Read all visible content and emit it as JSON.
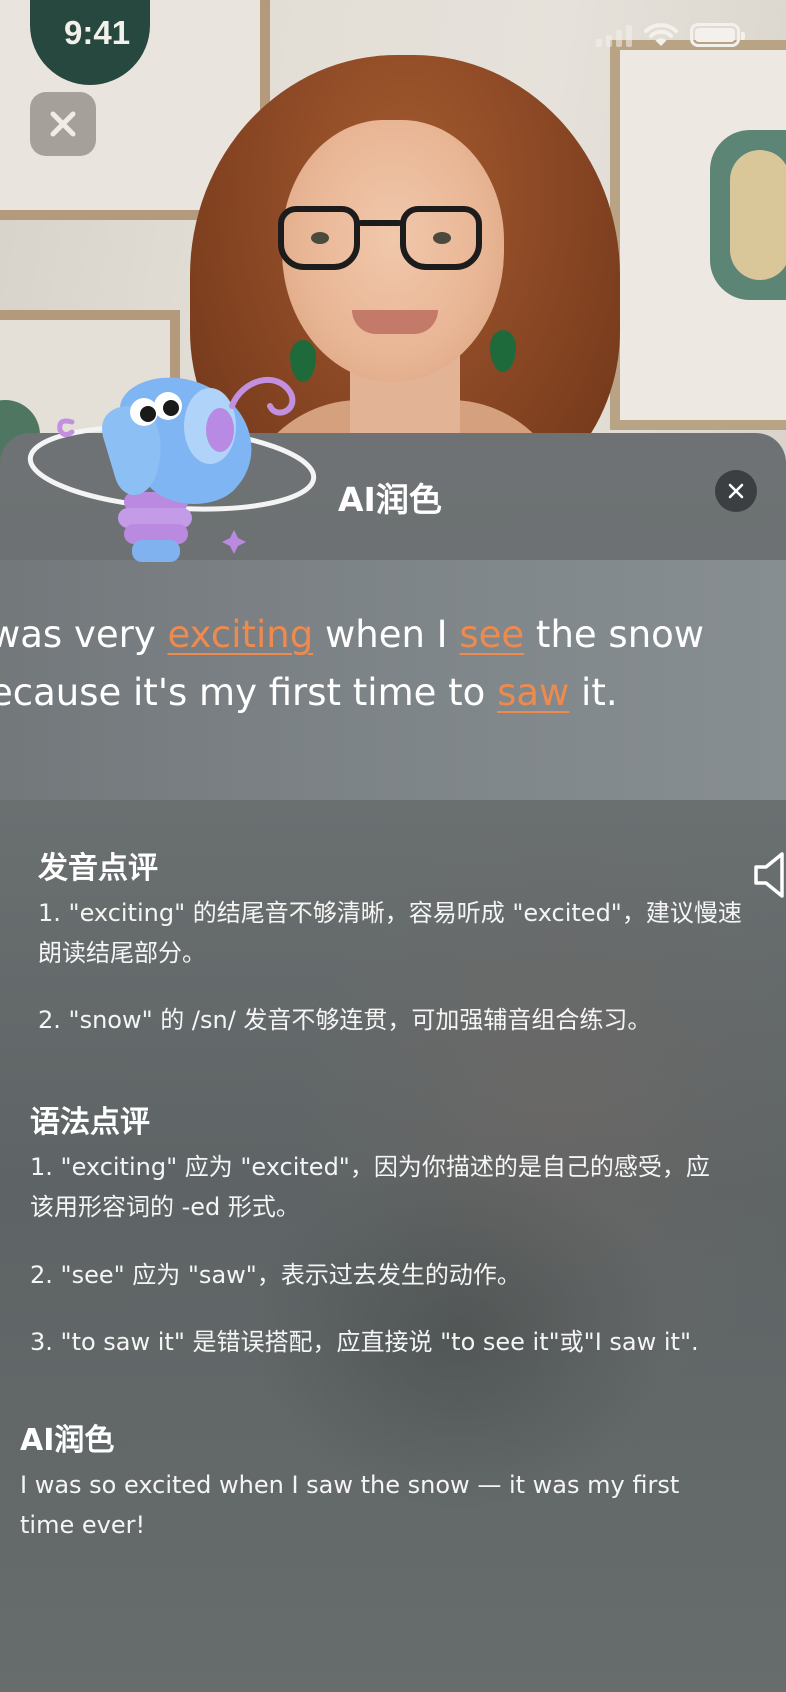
{
  "status_bar": {
    "time": "9:41"
  },
  "sheet": {
    "title": "AI润色",
    "sentence": {
      "line1": [
        {
          "text": "was very ",
          "error": false
        },
        {
          "text": "exciting",
          "error": true
        },
        {
          "text": " when I ",
          "error": false
        },
        {
          "text": "see",
          "error": true
        },
        {
          "text": " the snow",
          "error": false
        }
      ],
      "line2": [
        {
          "text": "ecause it's my first time to ",
          "error": false
        },
        {
          "text": "saw",
          "error": true
        },
        {
          "text": " it.",
          "error": false
        }
      ]
    },
    "pronunciation": {
      "title": "发音点评",
      "items": [
        "1. \"exciting\" 的结尾音不够清晰，容易听成 \"excited\"，建议慢速朗读结尾部分。",
        "2. \"snow\" 的 /sn/ 发音不够连贯，可加强辅音组合练习。"
      ]
    },
    "grammar": {
      "title": "语法点评",
      "items": [
        "1. \"exciting\" 应为 \"excited\"，因为你描述的是自己的感受，应该用形容词的 -ed 形式。",
        "2. \"see\" 应为 \"saw\"，表示过去发生的动作。",
        "3. \"to saw it\" 是错误搭配，应直接说 \"to see it\"或\"I saw it\"."
      ]
    },
    "polish": {
      "title": "AI润色",
      "text": "I was so excited when I saw the snow — it was my first time ever!"
    }
  },
  "colors": {
    "error_highlight": "#ee8a4e",
    "sheet_bg": "#6a6f70"
  },
  "icons": {
    "close": "close-icon",
    "speaker": "speaker-icon",
    "signal": "cellular-signal-icon",
    "wifi": "wifi-icon",
    "battery": "battery-icon"
  }
}
